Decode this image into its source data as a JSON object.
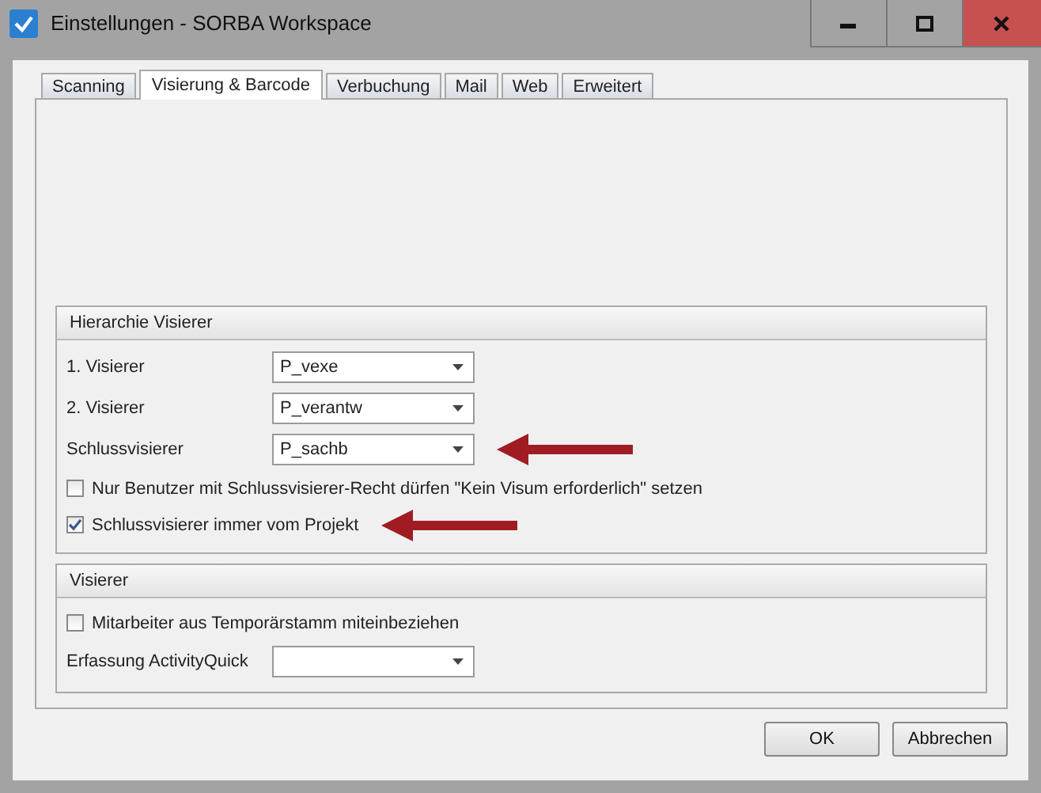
{
  "window": {
    "title": "Einstellungen - SORBA Workspace"
  },
  "tabs": [
    {
      "label": "Scanning",
      "selected": false
    },
    {
      "label": "Visierung & Barcode",
      "selected": true
    },
    {
      "label": "Verbuchung",
      "selected": false
    },
    {
      "label": "Mail",
      "selected": false
    },
    {
      "label": "Web",
      "selected": false
    },
    {
      "label": "Erweitert",
      "selected": false
    }
  ],
  "groups": [
    {
      "title": "Hierarchie Visierer",
      "rows": [
        {
          "kind": "combo",
          "label": "1. Visierer",
          "value": "P_vexe",
          "annotated": false
        },
        {
          "kind": "combo",
          "label": "2. Visierer",
          "value": "P_verantw",
          "annotated": false
        },
        {
          "kind": "combo",
          "label": "Schlussvisierer",
          "value": "P_sachb",
          "annotated": true
        },
        {
          "kind": "checkbox",
          "label": "Nur Benutzer mit Schlussvisierer-Recht dürfen \"Kein Visum erforderlich\" setzen",
          "checked": false,
          "annotated": false
        },
        {
          "kind": "checkbox",
          "label": "Schlussvisierer immer vom Projekt",
          "checked": true,
          "annotated": true
        }
      ]
    },
    {
      "title": "Visierer",
      "rows": [
        {
          "kind": "checkbox",
          "label": "Mitarbeiter aus Temporärstamm miteinbeziehen",
          "checked": false,
          "annotated": false
        },
        {
          "kind": "combo",
          "label": "Erfassung ActivityQuick",
          "annotated": false
        }
      ]
    }
  ],
  "buttons": [
    "OK",
    "Abbrechen"
  ]
}
